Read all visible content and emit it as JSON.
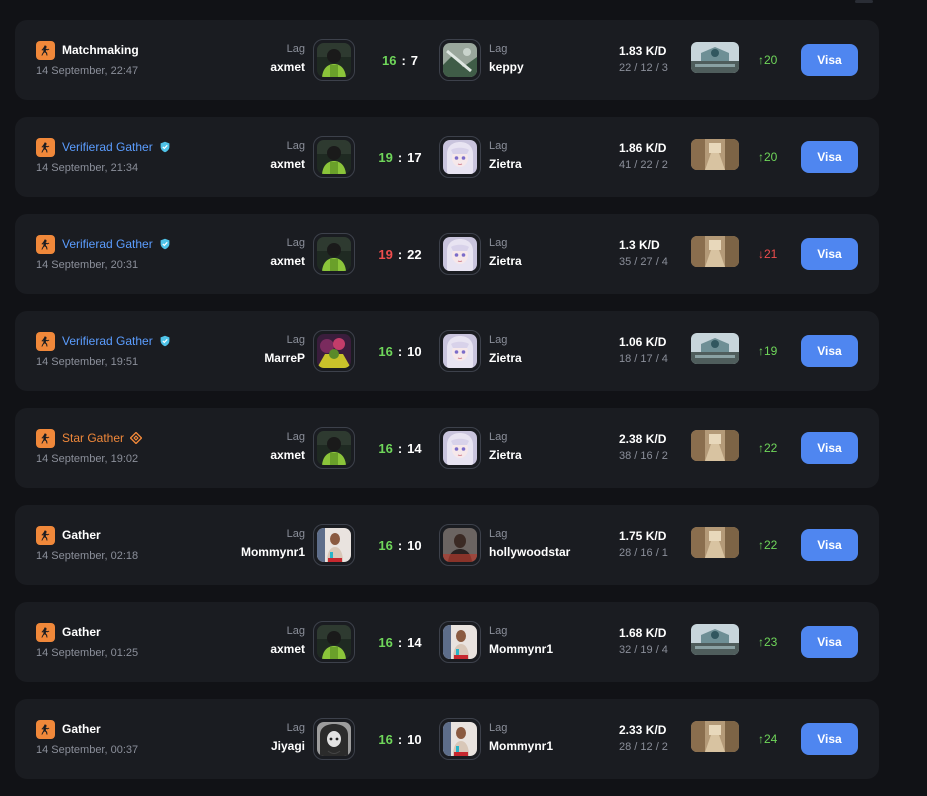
{
  "colors": {
    "background": "#111216",
    "card": "#1a1c21",
    "accent_orange": "#f0883a",
    "verified_blue": "#5b9dff",
    "win_green": "#6fd65a",
    "loss_red": "#ef4d4d",
    "button_blue": "#4f86f0",
    "muted_text": "#8b8f9a"
  },
  "matches": [
    {
      "mode": "Matchmaking",
      "mode_style": "plain",
      "badge": null,
      "date": "14 September, 22:47",
      "team_label": "Lag",
      "left_player": "axmet",
      "left_avatar": "dark-green-player-avatar",
      "score_left": "16",
      "score_sep": ":",
      "score_right": "7",
      "result": "win",
      "right_player": "keppy",
      "right_avatar": "gray-green-landscape-avatar",
      "kd": "1.83 K/D",
      "kda": "22 / 12 / 3",
      "map": "blue-dome-map-icon",
      "elo_arrow": "↑",
      "elo": "20",
      "elo_dir": "up",
      "button": "Visa"
    },
    {
      "mode": "Verifierad Gather",
      "mode_style": "verified",
      "badge": "verified-shield-icon",
      "date": "14 September, 21:34",
      "team_label": "Lag",
      "left_player": "axmet",
      "left_avatar": "dark-green-player-avatar",
      "score_left": "19",
      "score_sep": ":",
      "score_right": "17",
      "result": "win",
      "right_player": "Zietra",
      "right_avatar": "anime-girl-avatar",
      "kd": "1.86 K/D",
      "kda": "41 / 22 / 2",
      "map": "sand-street-map-icon",
      "elo_arrow": "↑",
      "elo": "20",
      "elo_dir": "up",
      "button": "Visa"
    },
    {
      "mode": "Verifierad Gather",
      "mode_style": "verified",
      "badge": "verified-shield-icon",
      "date": "14 September, 20:31",
      "team_label": "Lag",
      "left_player": "axmet",
      "left_avatar": "dark-green-player-avatar",
      "score_left": "19",
      "score_sep": ":",
      "score_right": "22",
      "result": "loss",
      "right_player": "Zietra",
      "right_avatar": "anime-girl-avatar",
      "kd": "1.3 K/D",
      "kda": "35 / 27 / 4",
      "map": "sand-street-map-icon",
      "elo_arrow": "↓",
      "elo": "21",
      "elo_dir": "down",
      "button": "Visa"
    },
    {
      "mode": "Verifierad Gather",
      "mode_style": "verified",
      "badge": "verified-shield-icon",
      "date": "14 September, 19:51",
      "team_label": "Lag",
      "left_player": "MarreP",
      "left_avatar": "purple-yellow-player-avatar",
      "score_left": "16",
      "score_sep": ":",
      "score_right": "10",
      "result": "win",
      "right_player": "Zietra",
      "right_avatar": "anime-girl-avatar",
      "kd": "1.06 K/D",
      "kda": "18 / 17 / 4",
      "map": "blue-dome-map-icon",
      "elo_arrow": "↑",
      "elo": "19",
      "elo_dir": "up",
      "button": "Visa"
    },
    {
      "mode": "Star Gather",
      "mode_style": "star",
      "badge": "star-diamond-icon",
      "date": "14 September, 19:02",
      "team_label": "Lag",
      "left_player": "axmet",
      "left_avatar": "dark-green-player-avatar",
      "score_left": "16",
      "score_sep": ":",
      "score_right": "14",
      "result": "win",
      "right_player": "Zietra",
      "right_avatar": "anime-girl-avatar",
      "kd": "2.38 K/D",
      "kda": "38 / 16 / 2",
      "map": "sand-street-map-icon",
      "elo_arrow": "↑",
      "elo": "22",
      "elo_dir": "up",
      "button": "Visa"
    },
    {
      "mode": "Gather",
      "mode_style": "plain",
      "badge": null,
      "date": "14 September, 02:18",
      "team_label": "Lag",
      "left_player": "Mommynr1",
      "left_avatar": "red-blue-person-avatar",
      "score_left": "16",
      "score_sep": ":",
      "score_right": "10",
      "result": "win",
      "right_player": "hollywoodstar",
      "right_avatar": "dark-portrait-avatar",
      "kd": "1.75 K/D",
      "kda": "28 / 16 / 1",
      "map": "sand-street-map-icon",
      "elo_arrow": "↑",
      "elo": "22",
      "elo_dir": "up",
      "button": "Visa"
    },
    {
      "mode": "Gather",
      "mode_style": "plain",
      "badge": null,
      "date": "14 September, 01:25",
      "team_label": "Lag",
      "left_player": "axmet",
      "left_avatar": "dark-green-player-avatar",
      "score_left": "16",
      "score_sep": ":",
      "score_right": "14",
      "result": "win",
      "right_player": "Mommynr1",
      "right_avatar": "red-blue-person-avatar",
      "kd": "1.68 K/D",
      "kda": "32 / 19 / 4",
      "map": "blue-dome-map-icon",
      "elo_arrow": "↑",
      "elo": "23",
      "elo_dir": "up",
      "button": "Visa"
    },
    {
      "mode": "Gather",
      "mode_style": "plain",
      "badge": null,
      "date": "14 September, 00:37",
      "team_label": "Lag",
      "left_player": "Jiyagi",
      "left_avatar": "grayscale-anime-avatar",
      "score_left": "16",
      "score_sep": ":",
      "score_right": "10",
      "result": "win",
      "right_player": "Mommynr1",
      "right_avatar": "red-blue-person-avatar",
      "kd": "2.33 K/D",
      "kda": "28 / 12 / 2",
      "map": "sand-street-map-icon",
      "elo_arrow": "↑",
      "elo": "24",
      "elo_dir": "up",
      "button": "Visa"
    }
  ]
}
